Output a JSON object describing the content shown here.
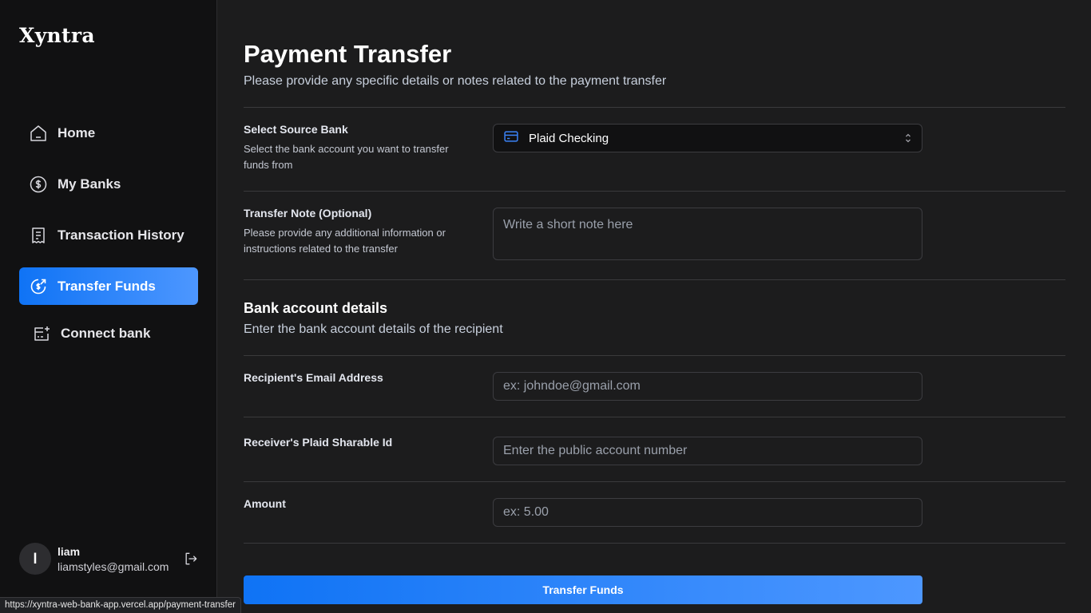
{
  "brand": {
    "name": "Xyntra"
  },
  "sidebar": {
    "items": [
      {
        "label": "Home",
        "icon": "home-icon"
      },
      {
        "label": "My Banks",
        "icon": "dollar-circle-icon"
      },
      {
        "label": "Transaction History",
        "icon": "receipt-icon"
      },
      {
        "label": "Transfer Funds",
        "icon": "money-send-icon",
        "active": true
      },
      {
        "label": "Connect bank",
        "icon": "card-add-icon"
      }
    ]
  },
  "user": {
    "initial": "l",
    "name": "liam",
    "email": "liamstyles@gmail.com"
  },
  "status_url": "https://xyntra-web-bank-app.vercel.app/payment-transfer",
  "page": {
    "title": "Payment Transfer",
    "subtitle": "Please provide any specific details or notes related to the payment transfer"
  },
  "form": {
    "source_bank": {
      "label": "Select Source Bank",
      "help": "Select the bank account you want to transfer funds from",
      "value": "Plaid Checking"
    },
    "note": {
      "label": "Transfer Note (Optional)",
      "help": "Please provide any additional information or instructions related to the transfer",
      "placeholder": "Write a short note here"
    },
    "details_section": {
      "title": "Bank account details",
      "subtitle": "Enter the bank account details of the recipient"
    },
    "email": {
      "label": "Recipient's Email Address",
      "placeholder": "ex: johndoe@gmail.com"
    },
    "sharable_id": {
      "label": "Receiver's Plaid Sharable Id",
      "placeholder": "Enter the public account number"
    },
    "amount": {
      "label": "Amount",
      "placeholder": "ex: 5.00"
    },
    "submit_label": "Transfer Funds"
  },
  "colors": {
    "accent": "#0f73f5",
    "accent_end": "#4d97ff",
    "card_icon": "#3b82f6"
  }
}
